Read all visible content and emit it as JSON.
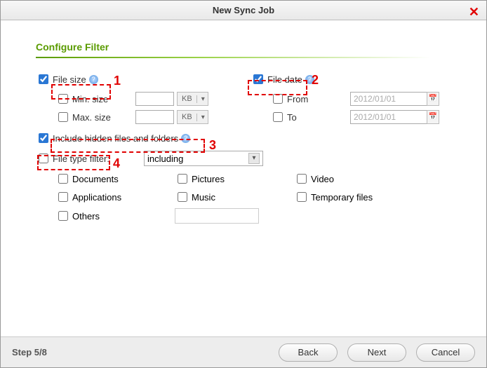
{
  "window": {
    "title": "New Sync Job"
  },
  "section": {
    "title": "Configure Filter"
  },
  "file_size": {
    "label": "File size",
    "min_label": "Min. size",
    "max_label": "Max. size",
    "unit": "KB"
  },
  "file_date": {
    "label": "File date",
    "from_label": "From",
    "to_label": "To",
    "from_value": "2012/01/01",
    "to_value": "2012/01/01"
  },
  "include_hidden": {
    "label": "Include hidden files and folders"
  },
  "file_type": {
    "label": "File type filter:",
    "mode": "including",
    "types": {
      "documents": "Documents",
      "pictures": "Pictures",
      "video": "Video",
      "applications": "Applications",
      "music": "Music",
      "temporary": "Temporary files",
      "others": "Others"
    }
  },
  "footer": {
    "step": "Step 5/8",
    "back": "Back",
    "next": "Next",
    "cancel": "Cancel"
  },
  "callouts": {
    "n1": "1",
    "n2": "2",
    "n3": "3",
    "n4": "4"
  }
}
